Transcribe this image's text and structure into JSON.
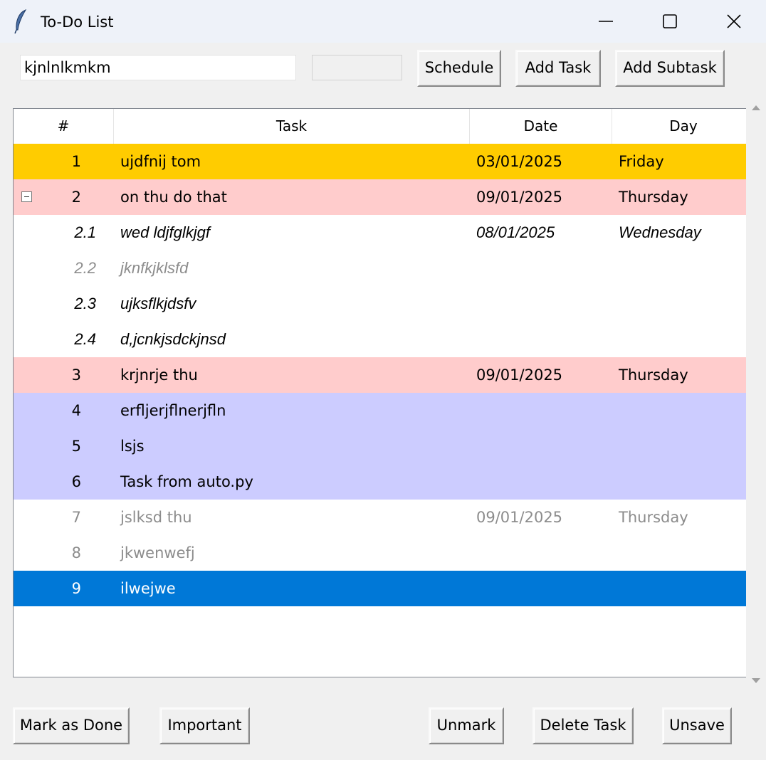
{
  "window": {
    "title": "To-Do List",
    "icon": "feather-icon",
    "controls": [
      "minimize-icon",
      "maximize-icon",
      "close-icon"
    ]
  },
  "entry": {
    "task_value": "kjnlnlkmkm",
    "date_value": ""
  },
  "toolbar": {
    "schedule_label": "Schedule",
    "add_task_label": "Add Task",
    "add_subtask_label": "Add Subtask"
  },
  "tree": {
    "columns": [
      "#",
      "Task",
      "Date",
      "Day"
    ],
    "rows": [
      {
        "num": "1",
        "task": "ujdfnij tom",
        "date": "03/01/2025",
        "day": "Friday",
        "style": "important"
      },
      {
        "num": "2",
        "task": "on thu do that",
        "date": "09/01/2025",
        "day": "Thursday",
        "style": "due",
        "expanded": true
      },
      {
        "num": "2.1",
        "task": "wed ldjfglkjgf",
        "date": "08/01/2025",
        "day": "Wednesday",
        "style": "subtask"
      },
      {
        "num": "2.2",
        "task": "jknfkjklsfd",
        "date": "",
        "day": "",
        "style": "subtask-done"
      },
      {
        "num": "2.3",
        "task": "ujksflkjdsfv",
        "date": "",
        "day": "",
        "style": "subtask"
      },
      {
        "num": "2.4",
        "task": "d,jcnkjsdckjnsd",
        "date": "",
        "day": "",
        "style": "subtask"
      },
      {
        "num": "3",
        "task": "krjnrje thu",
        "date": "09/01/2025",
        "day": "Thursday",
        "style": "due"
      },
      {
        "num": "4",
        "task": "erfljerjflnerjfln",
        "date": "",
        "day": "",
        "style": "scheduled"
      },
      {
        "num": "5",
        "task": "lsjs",
        "date": "",
        "day": "",
        "style": "scheduled"
      },
      {
        "num": "6",
        "task": "Task from auto.py",
        "date": "",
        "day": "",
        "style": "scheduled"
      },
      {
        "num": "7",
        "task": "jslksd thu",
        "date": "09/01/2025",
        "day": "Thursday",
        "style": "done"
      },
      {
        "num": "8",
        "task": "jkwenwefj",
        "date": "",
        "day": "",
        "style": "done"
      },
      {
        "num": "9",
        "task": "ilwejwe",
        "date": "",
        "day": "",
        "style": "selected"
      }
    ]
  },
  "actions": {
    "mark_done_label": "Mark as Done",
    "important_label": "Important",
    "unmark_label": "Unmark",
    "delete_label": "Delete Task",
    "unsave_label": "Unsave"
  },
  "colors": {
    "important": "#ffcc00",
    "due": "#ffcccc",
    "scheduled": "#ccccff",
    "selected": "#0078d7",
    "done_text": "#8c8c8c"
  }
}
